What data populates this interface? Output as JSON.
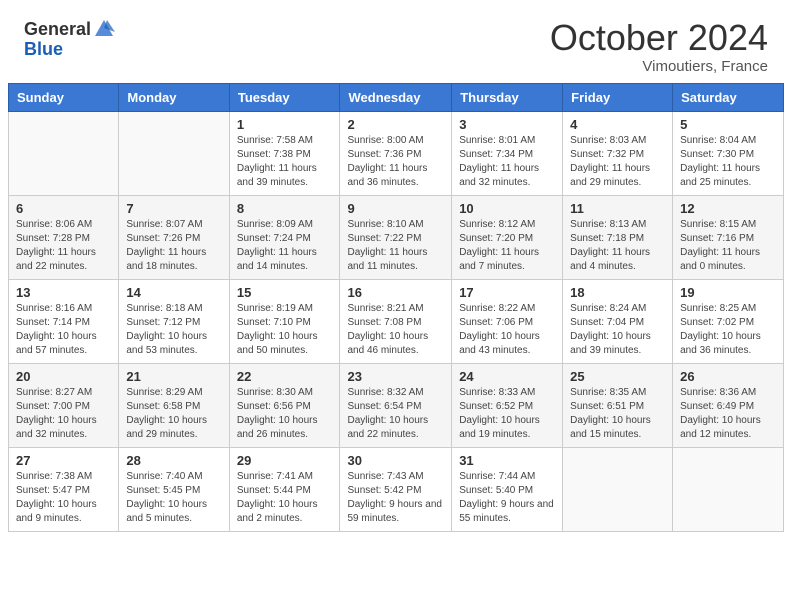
{
  "header": {
    "logo_general": "General",
    "logo_blue": "Blue",
    "month_title": "October 2024",
    "location": "Vimoutiers, France"
  },
  "days_of_week": [
    "Sunday",
    "Monday",
    "Tuesday",
    "Wednesday",
    "Thursday",
    "Friday",
    "Saturday"
  ],
  "weeks": [
    [
      {
        "day": "",
        "sunrise": "",
        "sunset": "",
        "daylight": ""
      },
      {
        "day": "",
        "sunrise": "",
        "sunset": "",
        "daylight": ""
      },
      {
        "day": "1",
        "sunrise": "Sunrise: 7:58 AM",
        "sunset": "Sunset: 7:38 PM",
        "daylight": "Daylight: 11 hours and 39 minutes."
      },
      {
        "day": "2",
        "sunrise": "Sunrise: 8:00 AM",
        "sunset": "Sunset: 7:36 PM",
        "daylight": "Daylight: 11 hours and 36 minutes."
      },
      {
        "day": "3",
        "sunrise": "Sunrise: 8:01 AM",
        "sunset": "Sunset: 7:34 PM",
        "daylight": "Daylight: 11 hours and 32 minutes."
      },
      {
        "day": "4",
        "sunrise": "Sunrise: 8:03 AM",
        "sunset": "Sunset: 7:32 PM",
        "daylight": "Daylight: 11 hours and 29 minutes."
      },
      {
        "day": "5",
        "sunrise": "Sunrise: 8:04 AM",
        "sunset": "Sunset: 7:30 PM",
        "daylight": "Daylight: 11 hours and 25 minutes."
      }
    ],
    [
      {
        "day": "6",
        "sunrise": "Sunrise: 8:06 AM",
        "sunset": "Sunset: 7:28 PM",
        "daylight": "Daylight: 11 hours and 22 minutes."
      },
      {
        "day": "7",
        "sunrise": "Sunrise: 8:07 AM",
        "sunset": "Sunset: 7:26 PM",
        "daylight": "Daylight: 11 hours and 18 minutes."
      },
      {
        "day": "8",
        "sunrise": "Sunrise: 8:09 AM",
        "sunset": "Sunset: 7:24 PM",
        "daylight": "Daylight: 11 hours and 14 minutes."
      },
      {
        "day": "9",
        "sunrise": "Sunrise: 8:10 AM",
        "sunset": "Sunset: 7:22 PM",
        "daylight": "Daylight: 11 hours and 11 minutes."
      },
      {
        "day": "10",
        "sunrise": "Sunrise: 8:12 AM",
        "sunset": "Sunset: 7:20 PM",
        "daylight": "Daylight: 11 hours and 7 minutes."
      },
      {
        "day": "11",
        "sunrise": "Sunrise: 8:13 AM",
        "sunset": "Sunset: 7:18 PM",
        "daylight": "Daylight: 11 hours and 4 minutes."
      },
      {
        "day": "12",
        "sunrise": "Sunrise: 8:15 AM",
        "sunset": "Sunset: 7:16 PM",
        "daylight": "Daylight: 11 hours and 0 minutes."
      }
    ],
    [
      {
        "day": "13",
        "sunrise": "Sunrise: 8:16 AM",
        "sunset": "Sunset: 7:14 PM",
        "daylight": "Daylight: 10 hours and 57 minutes."
      },
      {
        "day": "14",
        "sunrise": "Sunrise: 8:18 AM",
        "sunset": "Sunset: 7:12 PM",
        "daylight": "Daylight: 10 hours and 53 minutes."
      },
      {
        "day": "15",
        "sunrise": "Sunrise: 8:19 AM",
        "sunset": "Sunset: 7:10 PM",
        "daylight": "Daylight: 10 hours and 50 minutes."
      },
      {
        "day": "16",
        "sunrise": "Sunrise: 8:21 AM",
        "sunset": "Sunset: 7:08 PM",
        "daylight": "Daylight: 10 hours and 46 minutes."
      },
      {
        "day": "17",
        "sunrise": "Sunrise: 8:22 AM",
        "sunset": "Sunset: 7:06 PM",
        "daylight": "Daylight: 10 hours and 43 minutes."
      },
      {
        "day": "18",
        "sunrise": "Sunrise: 8:24 AM",
        "sunset": "Sunset: 7:04 PM",
        "daylight": "Daylight: 10 hours and 39 minutes."
      },
      {
        "day": "19",
        "sunrise": "Sunrise: 8:25 AM",
        "sunset": "Sunset: 7:02 PM",
        "daylight": "Daylight: 10 hours and 36 minutes."
      }
    ],
    [
      {
        "day": "20",
        "sunrise": "Sunrise: 8:27 AM",
        "sunset": "Sunset: 7:00 PM",
        "daylight": "Daylight: 10 hours and 32 minutes."
      },
      {
        "day": "21",
        "sunrise": "Sunrise: 8:29 AM",
        "sunset": "Sunset: 6:58 PM",
        "daylight": "Daylight: 10 hours and 29 minutes."
      },
      {
        "day": "22",
        "sunrise": "Sunrise: 8:30 AM",
        "sunset": "Sunset: 6:56 PM",
        "daylight": "Daylight: 10 hours and 26 minutes."
      },
      {
        "day": "23",
        "sunrise": "Sunrise: 8:32 AM",
        "sunset": "Sunset: 6:54 PM",
        "daylight": "Daylight: 10 hours and 22 minutes."
      },
      {
        "day": "24",
        "sunrise": "Sunrise: 8:33 AM",
        "sunset": "Sunset: 6:52 PM",
        "daylight": "Daylight: 10 hours and 19 minutes."
      },
      {
        "day": "25",
        "sunrise": "Sunrise: 8:35 AM",
        "sunset": "Sunset: 6:51 PM",
        "daylight": "Daylight: 10 hours and 15 minutes."
      },
      {
        "day": "26",
        "sunrise": "Sunrise: 8:36 AM",
        "sunset": "Sunset: 6:49 PM",
        "daylight": "Daylight: 10 hours and 12 minutes."
      }
    ],
    [
      {
        "day": "27",
        "sunrise": "Sunrise: 7:38 AM",
        "sunset": "Sunset: 5:47 PM",
        "daylight": "Daylight: 10 hours and 9 minutes."
      },
      {
        "day": "28",
        "sunrise": "Sunrise: 7:40 AM",
        "sunset": "Sunset: 5:45 PM",
        "daylight": "Daylight: 10 hours and 5 minutes."
      },
      {
        "day": "29",
        "sunrise": "Sunrise: 7:41 AM",
        "sunset": "Sunset: 5:44 PM",
        "daylight": "Daylight: 10 hours and 2 minutes."
      },
      {
        "day": "30",
        "sunrise": "Sunrise: 7:43 AM",
        "sunset": "Sunset: 5:42 PM",
        "daylight": "Daylight: 9 hours and 59 minutes."
      },
      {
        "day": "31",
        "sunrise": "Sunrise: 7:44 AM",
        "sunset": "Sunset: 5:40 PM",
        "daylight": "Daylight: 9 hours and 55 minutes."
      },
      {
        "day": "",
        "sunrise": "",
        "sunset": "",
        "daylight": ""
      },
      {
        "day": "",
        "sunrise": "",
        "sunset": "",
        "daylight": ""
      }
    ]
  ]
}
